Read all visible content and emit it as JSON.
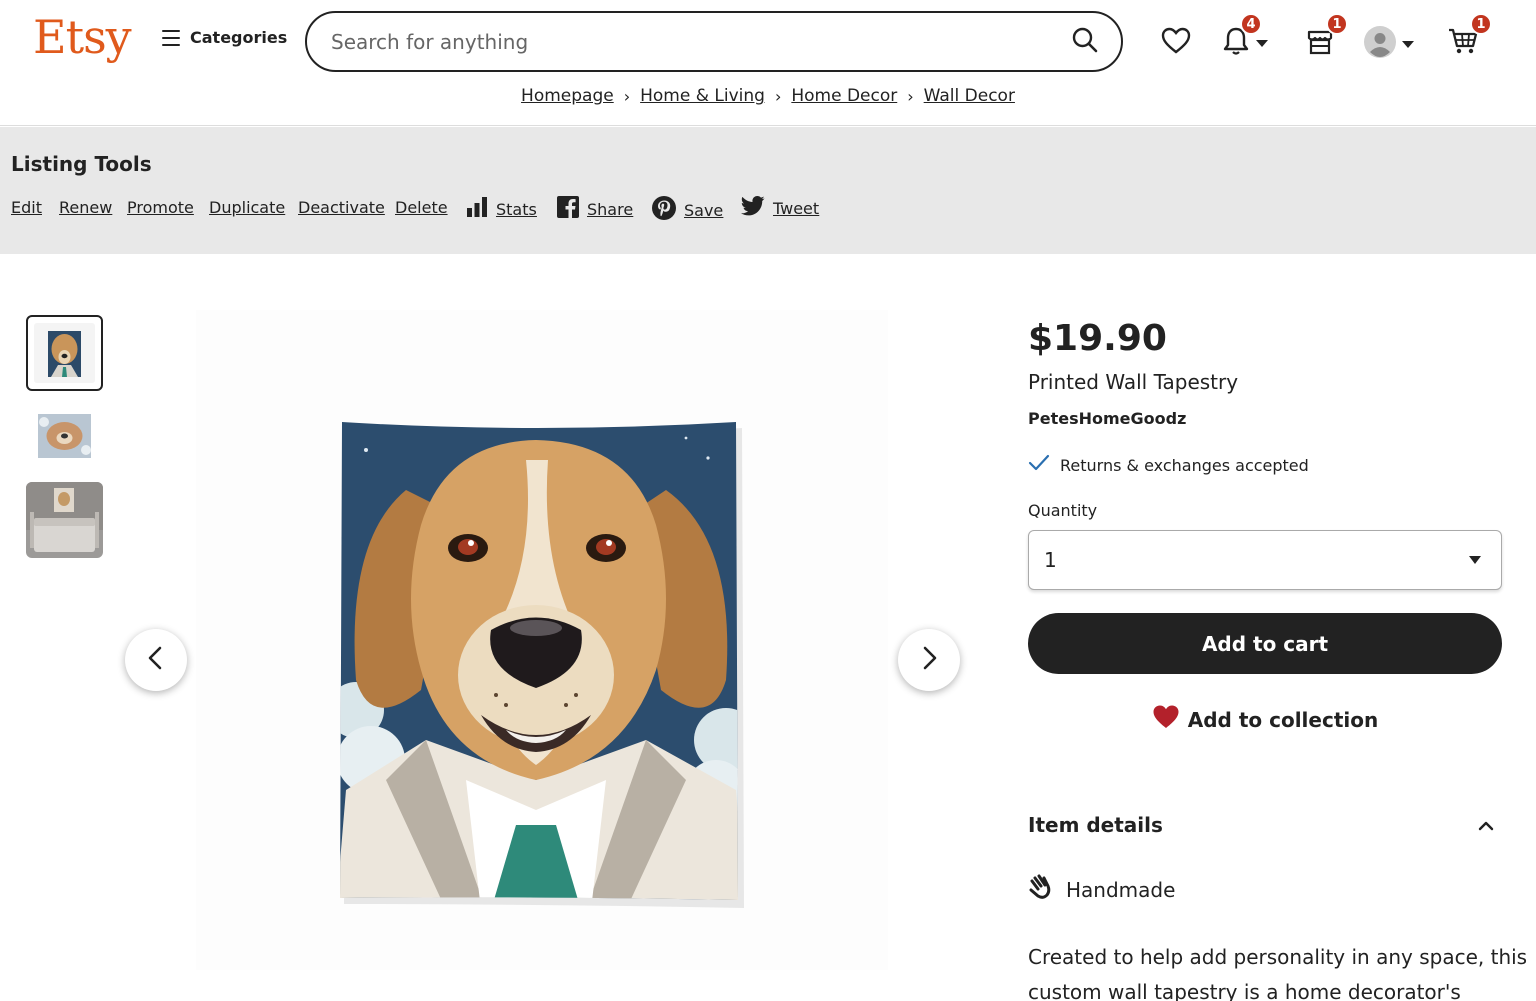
{
  "header": {
    "logo": "Etsy",
    "categories_label": "Categories",
    "search_placeholder": "Search for anything",
    "notifications_count": "4",
    "shop_manager_count": "1",
    "cart_count": "1"
  },
  "breadcrumb": [
    "Homepage",
    "Home & Living",
    "Home Decor",
    "Wall Decor"
  ],
  "listing_tools": {
    "title": "Listing Tools",
    "links": [
      "Edit",
      "Renew",
      "Promote",
      "Duplicate",
      "Deactivate",
      "Delete",
      "Stats",
      "Share",
      "Save",
      "Tweet"
    ]
  },
  "product": {
    "price": "$19.90",
    "title": "Printed Wall Tapestry",
    "shop_name": "PetesHomeGoodz",
    "returns": "Returns & exchanges accepted",
    "quantity_label": "Quantity",
    "quantity_value": "1",
    "add_to_cart": "Add to cart",
    "add_to_collection": "Add to collection",
    "item_details": "Item details",
    "handmade": "Handmade",
    "description": "Created to help add personality in any space, this custom wall tapestry is a home decorator's"
  },
  "colors": {
    "brand": "#e05a1c",
    "badge": "#c2351f",
    "button": "#222222",
    "tools_bg": "#e8e8e8",
    "check": "#2a6fb0",
    "heart": "#b3212b"
  }
}
